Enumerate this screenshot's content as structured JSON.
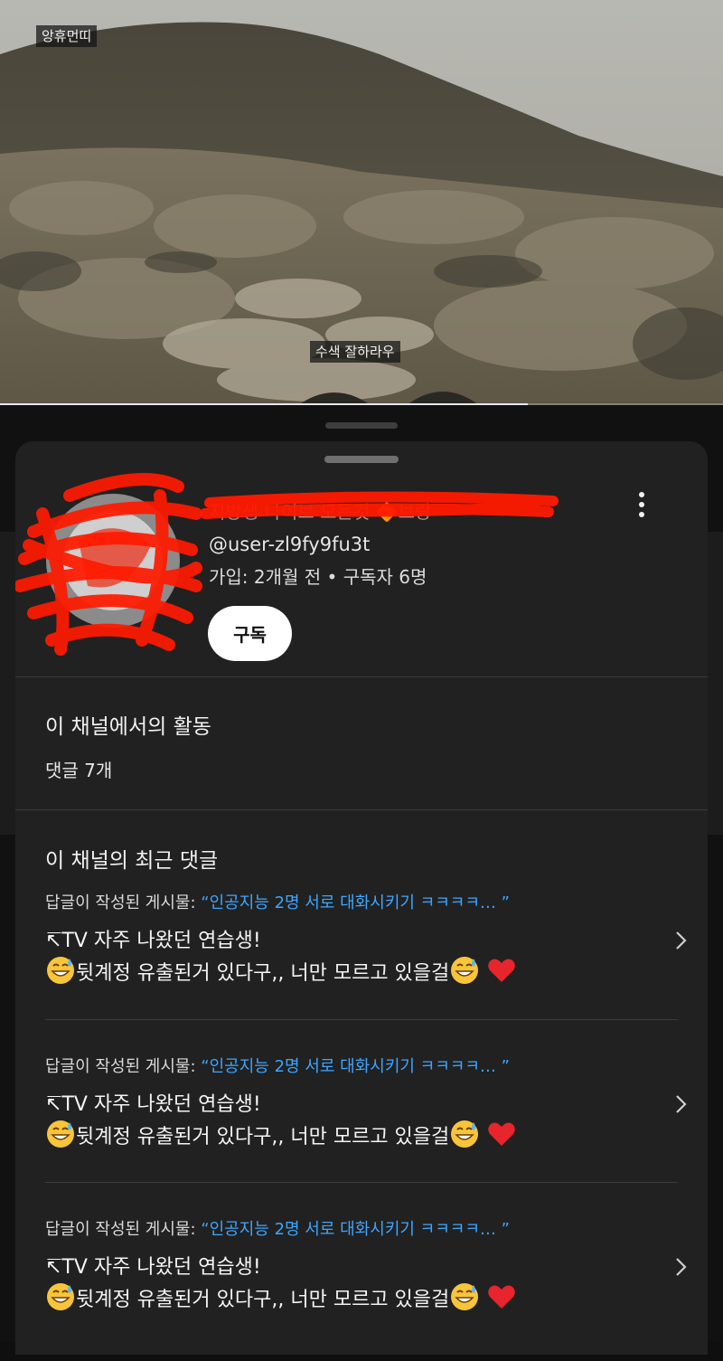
{
  "video": {
    "channel_watermark": "앙휴먼띠",
    "subtitle": "수색 잘하라우",
    "progress": 0.73
  },
  "channel": {
    "name": "지방생 나이브 모든것 🔶브랑",
    "handle": "@user-zl9fy9fu3t",
    "meta": "가입: 2개월 전 • 구독자 6명",
    "subscribe_label": "구독",
    "more_icon": "more-vert-icon"
  },
  "activity": {
    "title": "이 채널에서의 활동",
    "count": "댓글 7개"
  },
  "recent_comments": {
    "title": "이 채널의 최근 댓글",
    "items": [
      {
        "reply_prefix": "답글이 작성된 게시물: ",
        "post_title": "“인공지능 2명 서로 대화시키기 ㅋㅋㅋㅋ… ”",
        "line1": "↸TV 자주 나왔던 연습생!",
        "line2": "뒷계정 유출된거 있다구,, 너만 모르고 있을걸",
        "emojis": [
          "grinning-sweat-emoji",
          "red-heart-emoji"
        ]
      },
      {
        "reply_prefix": "답글이 작성된 게시물: ",
        "post_title": "“인공지능 2명 서로 대화시키기 ㅋㅋㅋㅋ… ”",
        "line1": "↸TV 자주 나왔던 연습생!",
        "line2": "뒷계정 유출된거 있다구,, 너만 모르고 있을걸",
        "emojis": [
          "grinning-sweat-emoji",
          "red-heart-emoji"
        ]
      },
      {
        "reply_prefix": "답글이 작성된 게시물: ",
        "post_title": "“인공지능 2명 서로 대화시키기 ㅋㅋㅋㅋ… ”",
        "line1": "↸TV 자주 나왔던 연습생!",
        "line2": "뒷계정 유출된거 있다구,, 너만 모르고 있을걸",
        "emojis": [
          "grinning-sweat-emoji",
          "red-heart-emoji"
        ]
      }
    ]
  },
  "colors": {
    "sheet_bg": "#212121",
    "link_blue": "#3ea6ff",
    "scribble_red": "#ff1a00"
  }
}
